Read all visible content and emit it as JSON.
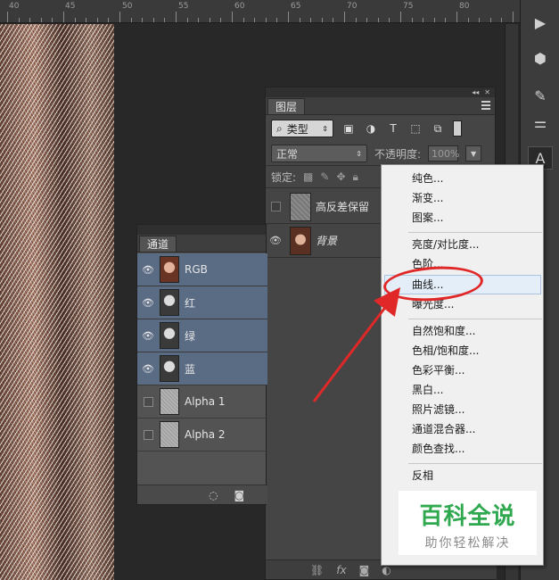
{
  "ruler": {
    "labels": [
      "40",
      "45",
      "50",
      "55",
      "60",
      "65",
      "70",
      "75",
      "80"
    ]
  },
  "toolstrip": {
    "icons": [
      "play-icon",
      "cube-icon",
      "brush-settings-icon",
      "sliders-icon",
      "character-icon"
    ],
    "text_tool_glyph": "A"
  },
  "layers_panel": {
    "tab": "图层",
    "filter_kind": "类型",
    "blend_mode": "正常",
    "opacity_label": "不透明度:",
    "opacity_value": "100%",
    "lock_label": "锁定:",
    "layers": [
      {
        "name": "高反差保留",
        "visible": false
      },
      {
        "name": "背景",
        "visible": true
      }
    ],
    "bottom_icons": [
      "link-icon",
      "fx-icon",
      "mask-icon",
      "adjustment-icon"
    ]
  },
  "channels_panel": {
    "tab": "通道",
    "channels": [
      {
        "name": "RGB",
        "selected": true,
        "visible": true
      },
      {
        "name": "红",
        "selected": true,
        "visible": true
      },
      {
        "name": "绿",
        "selected": true,
        "visible": true
      },
      {
        "name": "蓝",
        "selected": true,
        "visible": true
      },
      {
        "name": "Alpha 1",
        "selected": false,
        "visible": false
      },
      {
        "name": "Alpha 2",
        "selected": false,
        "visible": false
      }
    ]
  },
  "adjust_menu": {
    "items": [
      "纯色...",
      "渐变...",
      "图案...",
      "亮度/对比度...",
      "色阶...",
      "曲线...",
      "曝光度...",
      "自然饱和度...",
      "色相/饱和度...",
      "色彩平衡...",
      "黑白...",
      "照片滤镜...",
      "通道混合器...",
      "颜色查找...",
      "反相"
    ],
    "highlighted": "曲线..."
  },
  "watermark": {
    "main": "百科全说",
    "sub": "助你轻松解决"
  },
  "colors": {
    "highlight_red": "#e02828",
    "channel_selected": "#5a6b84",
    "watermark_green": "#2fa84f"
  }
}
